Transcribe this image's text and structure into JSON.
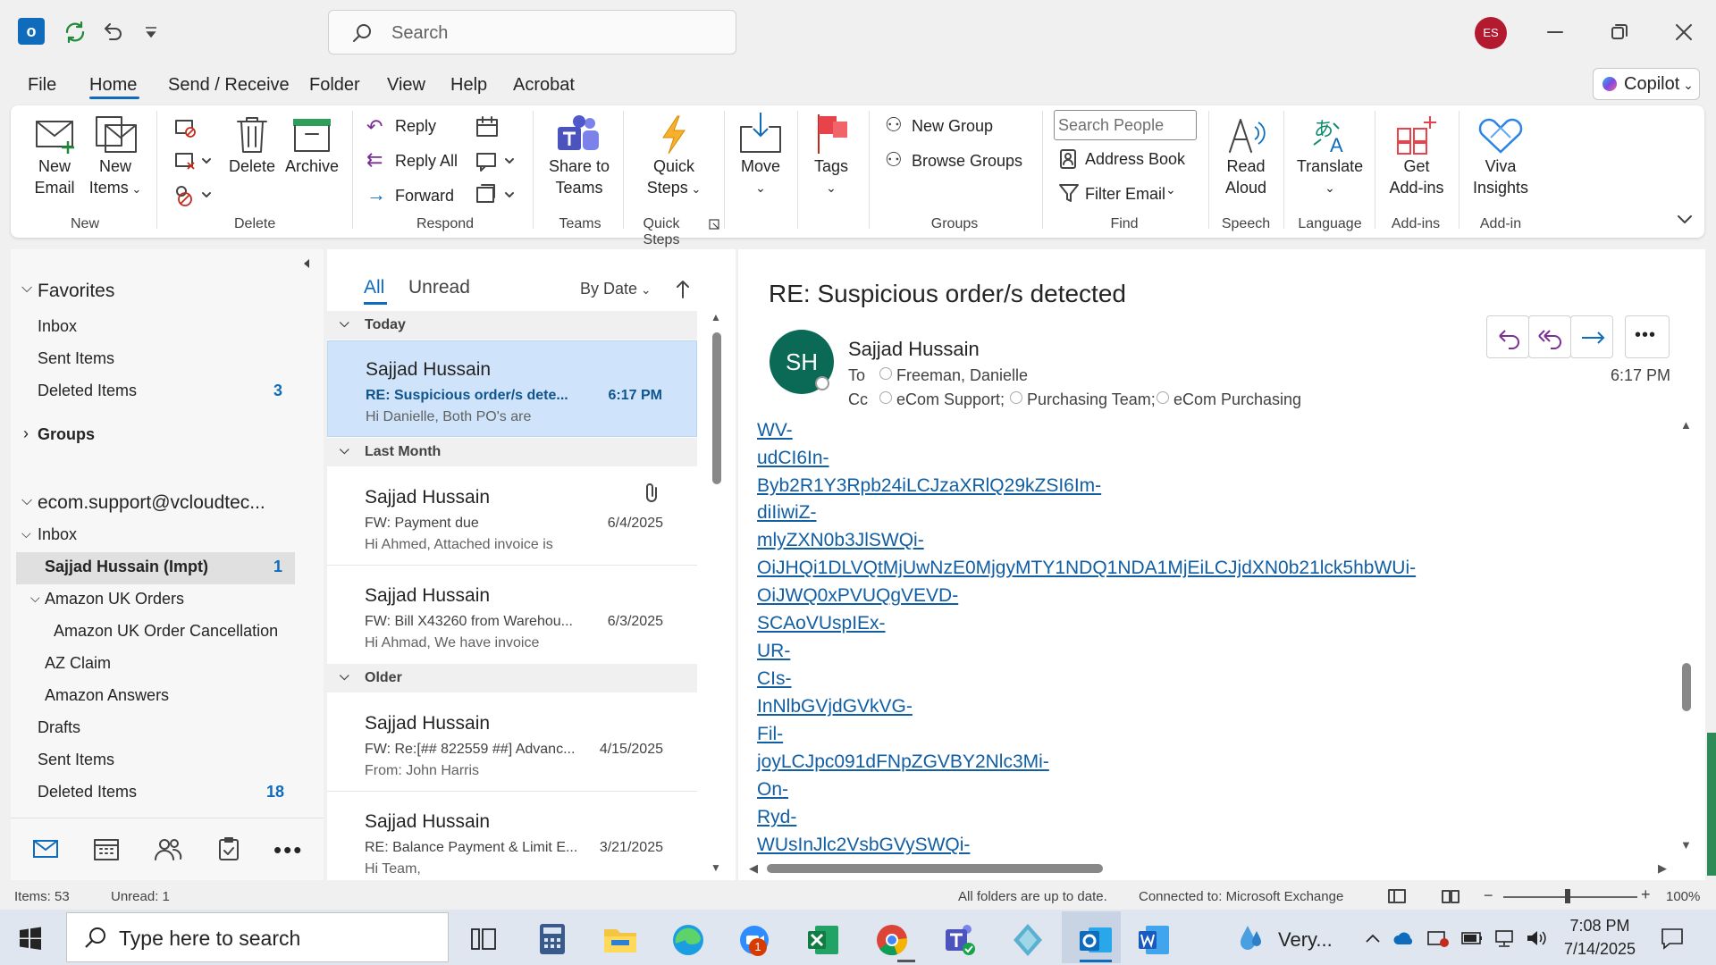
{
  "titlebar": {
    "search_placeholder": "Search",
    "avatar_initials": "ES"
  },
  "menu": {
    "items": [
      "File",
      "Home",
      "Send / Receive",
      "Folder",
      "View",
      "Help",
      "Acrobat"
    ],
    "copilot": "Copilot"
  },
  "ribbon": {
    "new_email": [
      "New",
      "Email"
    ],
    "new_items": [
      "New",
      "Items"
    ],
    "delete": "Delete",
    "archive": "Archive",
    "reply": "Reply",
    "reply_all": "Reply All",
    "forward": "Forward",
    "share_teams": [
      "Share to",
      "Teams"
    ],
    "quick_steps": [
      "Quick",
      "Steps"
    ],
    "move": "Move",
    "tags": "Tags",
    "new_group": "New Group",
    "browse_groups": "Browse Groups",
    "search_people": "Search People",
    "address_book": "Address Book",
    "filter_email": "Filter Email",
    "read_aloud": [
      "Read",
      "Aloud"
    ],
    "translate": "Translate",
    "get_addins": [
      "Get",
      "Add-ins"
    ],
    "viva": [
      "Viva",
      "Insights"
    ],
    "groups": [
      "New",
      "Delete",
      "Respond",
      "Teams",
      "Quick Steps",
      "Groups",
      "Find",
      "Speech",
      "Language",
      "Add-ins",
      "Add-in"
    ]
  },
  "nav": {
    "favorites": "Favorites",
    "fav_items": [
      {
        "label": "Inbox"
      },
      {
        "label": "Sent Items"
      },
      {
        "label": "Deleted Items",
        "count": "3"
      }
    ],
    "groups": "Groups",
    "account": "ecom.support@vcloudtec...",
    "inbox": "Inbox",
    "selected": {
      "label": "Sajjad Hussain (Impt)",
      "count": "1"
    },
    "amazon_uk": "Amazon UK Orders",
    "amazon_uk_cancel": "Amazon UK Order Cancellation",
    "az_claim": "AZ Claim",
    "amazon_answers": "Amazon Answers",
    "drafts": "Drafts",
    "sent": "Sent Items",
    "deleted": {
      "label": "Deleted Items",
      "count": "18"
    }
  },
  "list": {
    "filters": {
      "all": "All",
      "unread": "Unread",
      "sort": "By Date"
    },
    "groups": {
      "today": "Today",
      "last_month": "Last Month",
      "older": "Older"
    },
    "messages": [
      {
        "sender": "Sajjad Hussain",
        "subject": "RE: Suspicious order/s dete...",
        "preview": "Hi Danielle,   Both PO's are",
        "date": "6:17 PM"
      },
      {
        "sender": "Sajjad Hussain",
        "subject": "FW: Payment due",
        "preview": "Hi Ahmed,   Attached invoice is",
        "date": "6/4/2025"
      },
      {
        "sender": "Sajjad Hussain",
        "subject": "FW: Bill X43260 from Warehou...",
        "preview": "Hi Ahmad,   We have invoice",
        "date": "6/3/2025"
      },
      {
        "sender": "Sajjad Hussain",
        "subject": "FW: Re:[## 822559 ##] Advanc...",
        "preview": "From: John Harris",
        "date": "4/15/2025"
      },
      {
        "sender": "Sajjad Hussain",
        "subject": "RE: Balance Payment & Limit E...",
        "preview": "Hi Team,",
        "date": "3/21/2025"
      }
    ]
  },
  "reading": {
    "subject": "RE: Suspicious order/s detected",
    "sender_initials": "SH",
    "sender": "Sajjad Hussain",
    "to_label": "To",
    "to": "Freeman, Danielle",
    "cc_label": "Cc",
    "cc": [
      "eCom Support;",
      "Purchasing Team;",
      "eCom Purchasing"
    ],
    "time": "6:17 PM",
    "body_lines": [
      "WV-",
      "udCI6In-",
      "Byb2R1Y3Rpb24iLCJzaXRlQ29kZSI6Im-",
      "diIiwiZ-",
      "mlyZXN0b3JlSWQi-",
      "OiJHQi1DLVQtMjUwNzE0MjgyMTY1NDQ1NDA1MjEiLCJjdXN0b21lck5hbWUi-",
      "OiJWQ0xPVUQgVEVD-",
      "SCAoVUspIEx-",
      "UR-",
      "CIs-",
      "InNlbGVjdGVkVG-",
      "Fil-",
      "joyLCJpc091dFNpZGVBY2Nlc3Mi-",
      "On-",
      "Ryd-",
      "WUsInJlc2VsbGVySWQi-"
    ]
  },
  "status": {
    "items": "Items: 53",
    "unread": "Unread: 1",
    "sync": "All folders are up to date.",
    "connected": "Connected to: Microsoft Exchange",
    "zoom": "100%"
  },
  "taskbar": {
    "search": "Type here to search",
    "weather": "Very...",
    "time": "7:08 PM",
    "date": "7/14/2025",
    "zoom_badge": "1"
  }
}
